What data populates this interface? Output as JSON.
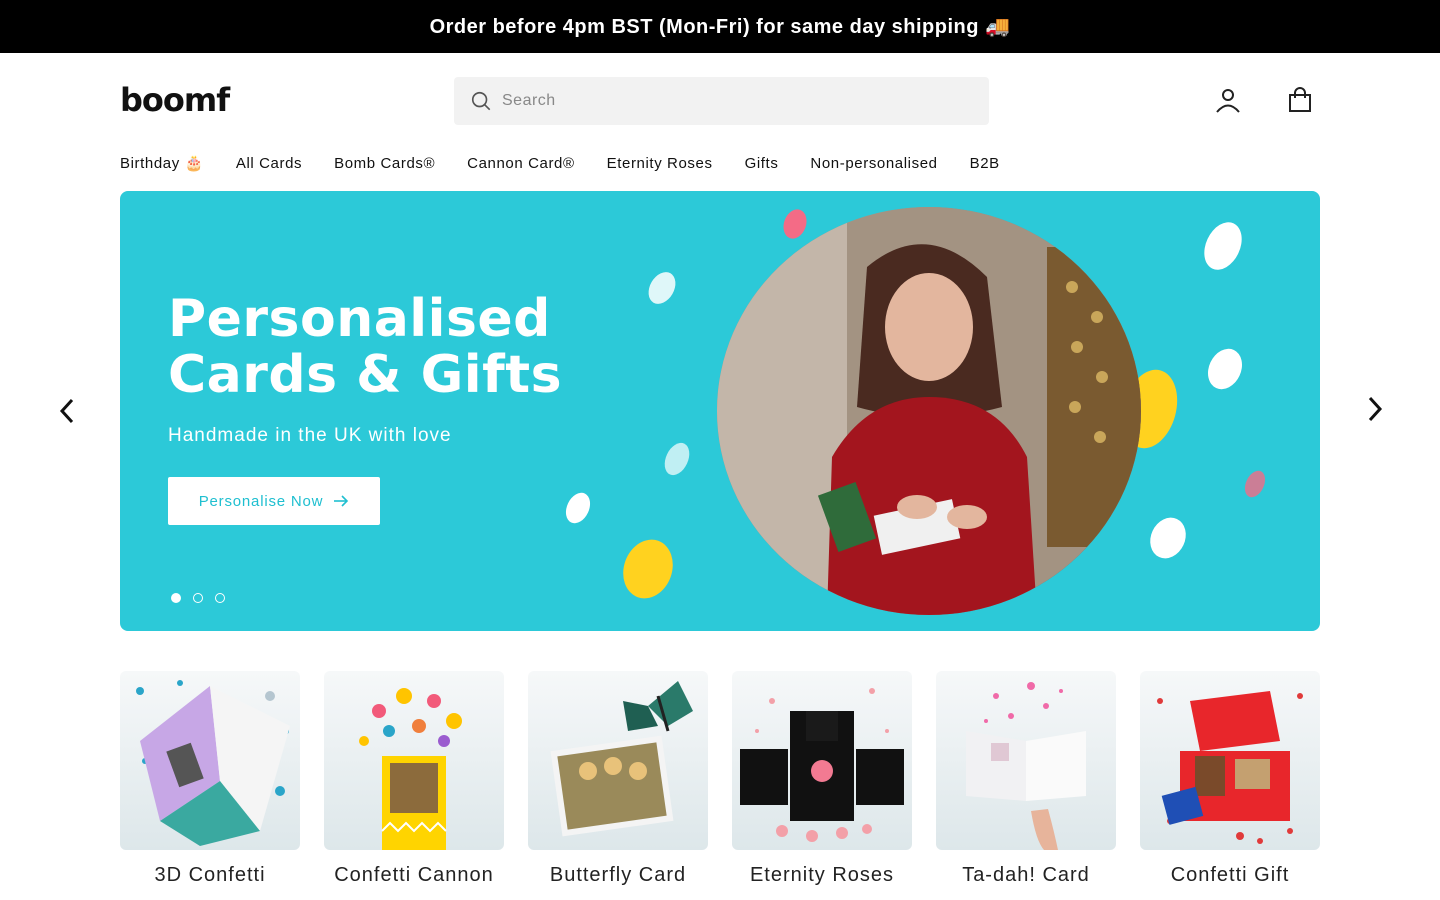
{
  "announcement": {
    "text": "Order before 4pm BST (Mon-Fri) for same day shipping 🚚"
  },
  "header": {
    "logo": "boomf",
    "search_placeholder": "Search",
    "account_icon": "user-icon",
    "cart_icon": "shopping-bag-icon"
  },
  "nav": {
    "items": [
      {
        "label": "Birthday 🎂"
      },
      {
        "label": "All Cards"
      },
      {
        "label": "Bomb Cards®"
      },
      {
        "label": "Cannon Card®"
      },
      {
        "label": "Eternity Roses"
      },
      {
        "label": "Gifts"
      },
      {
        "label": "Non-personalised"
      },
      {
        "label": "B2B"
      }
    ]
  },
  "hero": {
    "title_line1": "Personalised",
    "title_line2": "Cards & Gifts",
    "subtitle": "Handmade in the UK with love",
    "cta_label": "Personalise Now",
    "background_color": "#2cc9d8",
    "slides_total": 3,
    "active_slide": 1
  },
  "products": [
    {
      "label": "3D Confetti"
    },
    {
      "label": "Confetti Cannon"
    },
    {
      "label": "Butterfly Card"
    },
    {
      "label": "Eternity Roses"
    },
    {
      "label": "Ta-dah! Card"
    },
    {
      "label": "Confetti Gift"
    }
  ]
}
